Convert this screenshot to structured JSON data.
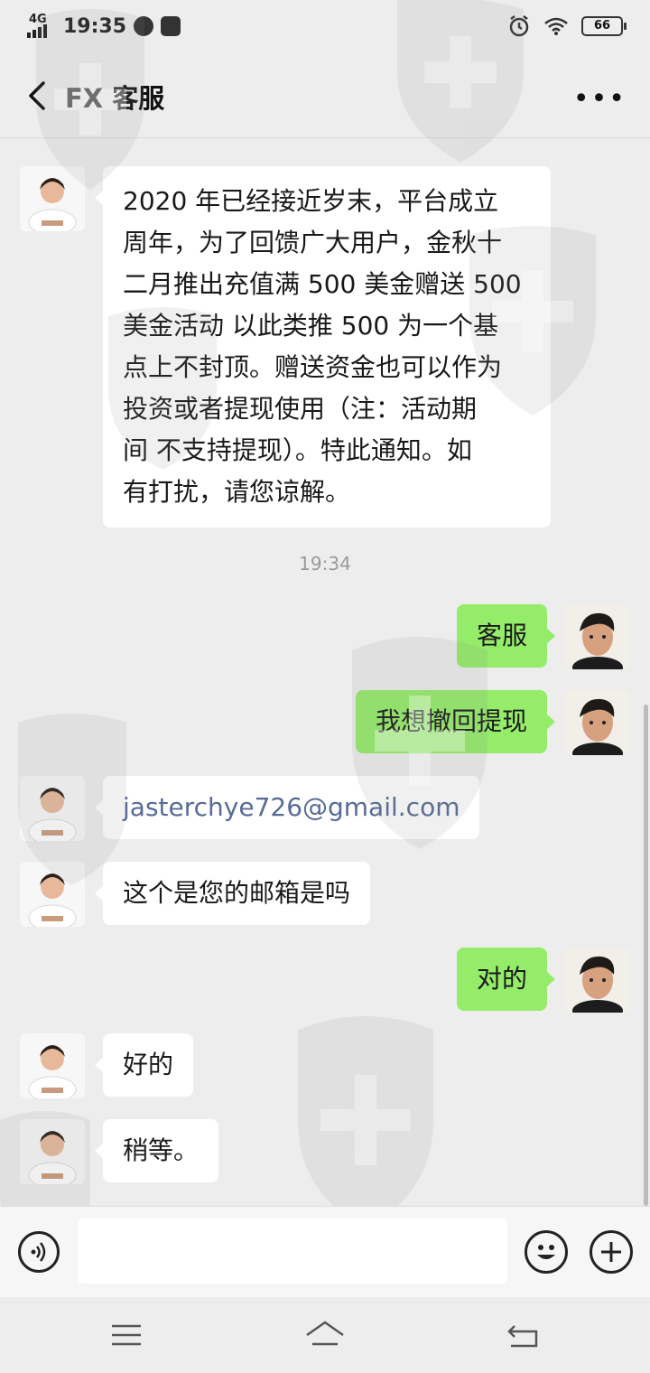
{
  "status_bar": {
    "network": "4G",
    "time": "19:35",
    "battery": "66"
  },
  "header": {
    "title": "FX 客服"
  },
  "messages": {
    "m1": {
      "lines": [
        "2020 年已经接近岁末，平台成立",
        "周年，为了回馈广大用户，金秋十",
        "二月推出充值满 500 美金赠送 500",
        "美金活动 以此类推 500 为一个基",
        "点上不封顶。赠送资金也可以作为",
        "投资或者提现使用（注：活动期",
        "间 不支持提现）。特此通知。如",
        "有打扰，请您谅解。"
      ]
    },
    "timestamp": "19:34",
    "m2": "客服",
    "m3": "我想撤回提现",
    "m4": "jasterchye726@gmail.com",
    "m5": "这个是您的邮箱是吗",
    "m6": "对的",
    "m7": "好的",
    "m8": "稍等。"
  },
  "icons": {
    "back": "chevron-left-icon",
    "more": "more-dots-icon",
    "voice": "voice-icon",
    "emoji": "emoji-icon",
    "plus": "plus-icon"
  },
  "colors": {
    "my_bubble": "#95ec69",
    "link": "#576b95",
    "background": "#ededed"
  }
}
